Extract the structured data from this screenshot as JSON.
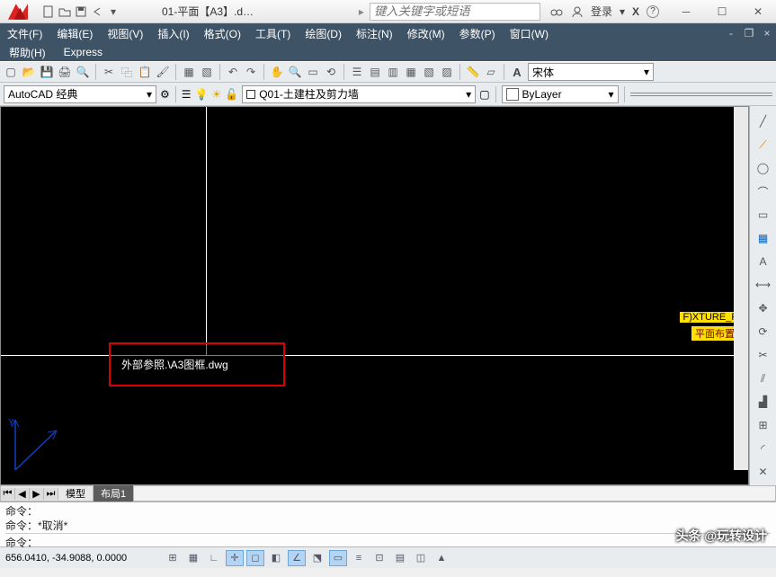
{
  "title": "01-平面【A3】.d…",
  "search_placeholder": "键入关键字或短语",
  "login_label": "登录",
  "menus": [
    "文件(F)",
    "编辑(E)",
    "视图(V)",
    "插入(I)",
    "格式(O)",
    "工具(T)",
    "绘图(D)",
    "标注(N)",
    "修改(M)",
    "参数(P)",
    "窗口(W)"
  ],
  "menus2": [
    "帮助(H)",
    "Express"
  ],
  "workspace": "AutoCAD 经典",
  "layer_current": "Q01-土建柱及剪力墙",
  "bylayer": "ByLayer",
  "font": "宋体",
  "tooltip": "外部参照.\\A3图框.dwg",
  "yellow1": "F)XTURE_FU",
  "yellow2": "平面布置图",
  "tabs": {
    "model": "模型",
    "layout1": "布局1"
  },
  "cmd": {
    "p1": "命令：",
    "p2": "命令：*取消*",
    "prompt": "命令："
  },
  "watermark": "头条 @玩转设计",
  "coords": "656.0410, -34.9088, 0.0000"
}
